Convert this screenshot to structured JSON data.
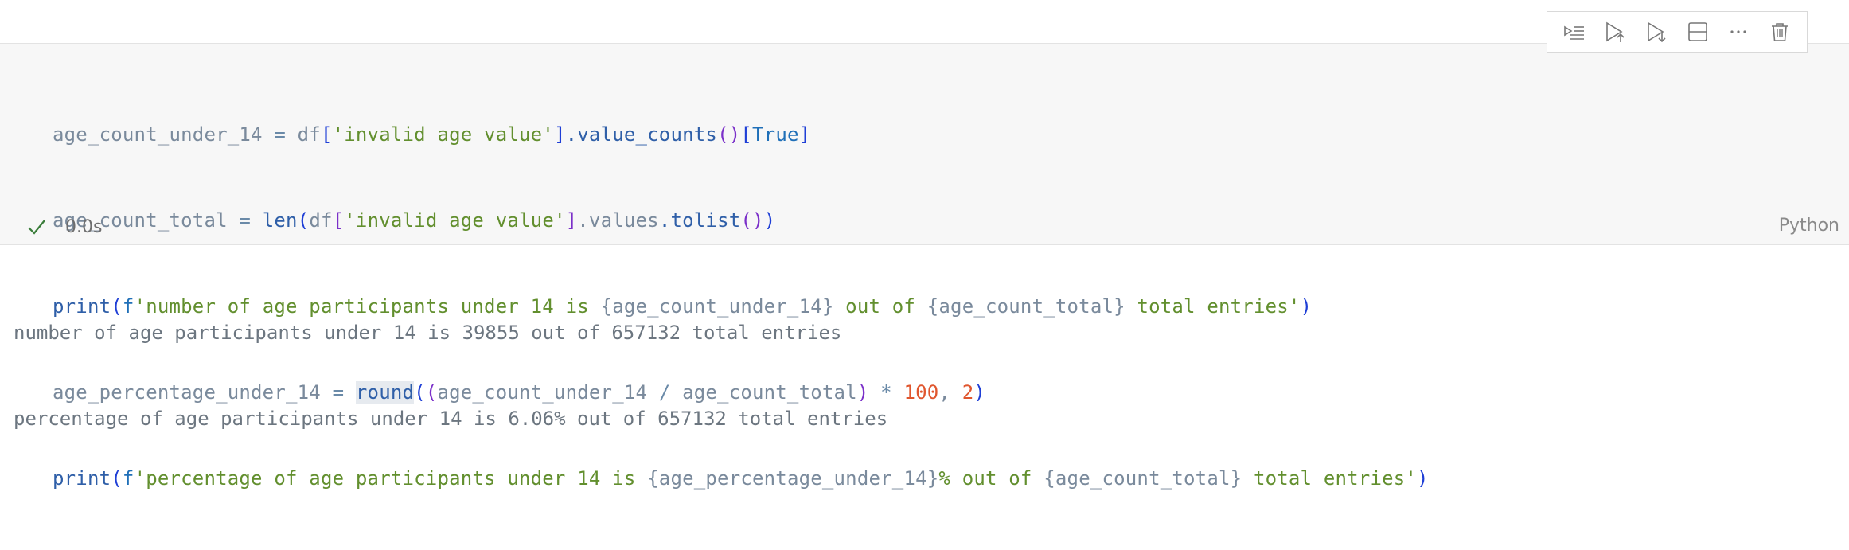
{
  "toolbar": {
    "buttons": [
      {
        "name": "execute-above-icon"
      },
      {
        "name": "run-above-icon"
      },
      {
        "name": "run-below-icon"
      },
      {
        "name": "split-cell-icon"
      },
      {
        "name": "more-icon"
      },
      {
        "name": "delete-icon"
      }
    ]
  },
  "code": {
    "l1": {
      "v1": "age_count_under_14",
      "op": " = ",
      "df": "df",
      "b1": "[",
      "s1": "'invalid age value'",
      "b2": "]",
      "m1": ".value_counts",
      "p1": "()",
      "b3": "[",
      "kw": "True",
      "b4": "]"
    },
    "l2": {
      "v1": "age_count_total",
      "op": " = ",
      "len": "len",
      "po": "(",
      "df": "df",
      "b1": "[",
      "s1": "'invalid age value'",
      "b2": "]",
      "m1": ".values",
      "m2": ".tolist",
      "p1": "()",
      "pc": ")"
    },
    "l3": {
      "print": "print",
      "po": "(",
      "f": "f",
      "s1": "'number of age participants under 14 is ",
      "c1o": "{",
      "v1": "age_count_under_14",
      "c1c": "}",
      "s2": " out of ",
      "c2o": "{",
      "v2": "age_count_total",
      "c2c": "}",
      "s3": " total entries'",
      "pc": ")"
    },
    "l4": {
      "v1": "age_percentage_under_14",
      "op": " = ",
      "round": "round",
      "po": "(",
      "pi": "(",
      "v2": "age_count_under_14",
      "div": " / ",
      "v3": "age_count_total",
      "pic": ")",
      "mul": " * ",
      "n1": "100",
      "comma": ", ",
      "n2": "2",
      "pc": ")"
    },
    "l5": {
      "print": "print",
      "po": "(",
      "f": "f",
      "s1": "'percentage of age participants under 14 is ",
      "c1o": "{",
      "v1": "age_percentage_under_14",
      "c1c": "}",
      "s2": "% out of ",
      "c2o": "{",
      "v2": "age_count_total",
      "c2c": "}",
      "s3": " total entries'",
      "pc": ")"
    }
  },
  "status": {
    "check_icon": "check-icon",
    "time": "0.0s"
  },
  "language": "Python",
  "output": [
    "number of age participants under 14 is 39855 out of 657132 total entries",
    "percentage of age participants under 14 is 6.06% out of 657132 total entries"
  ]
}
